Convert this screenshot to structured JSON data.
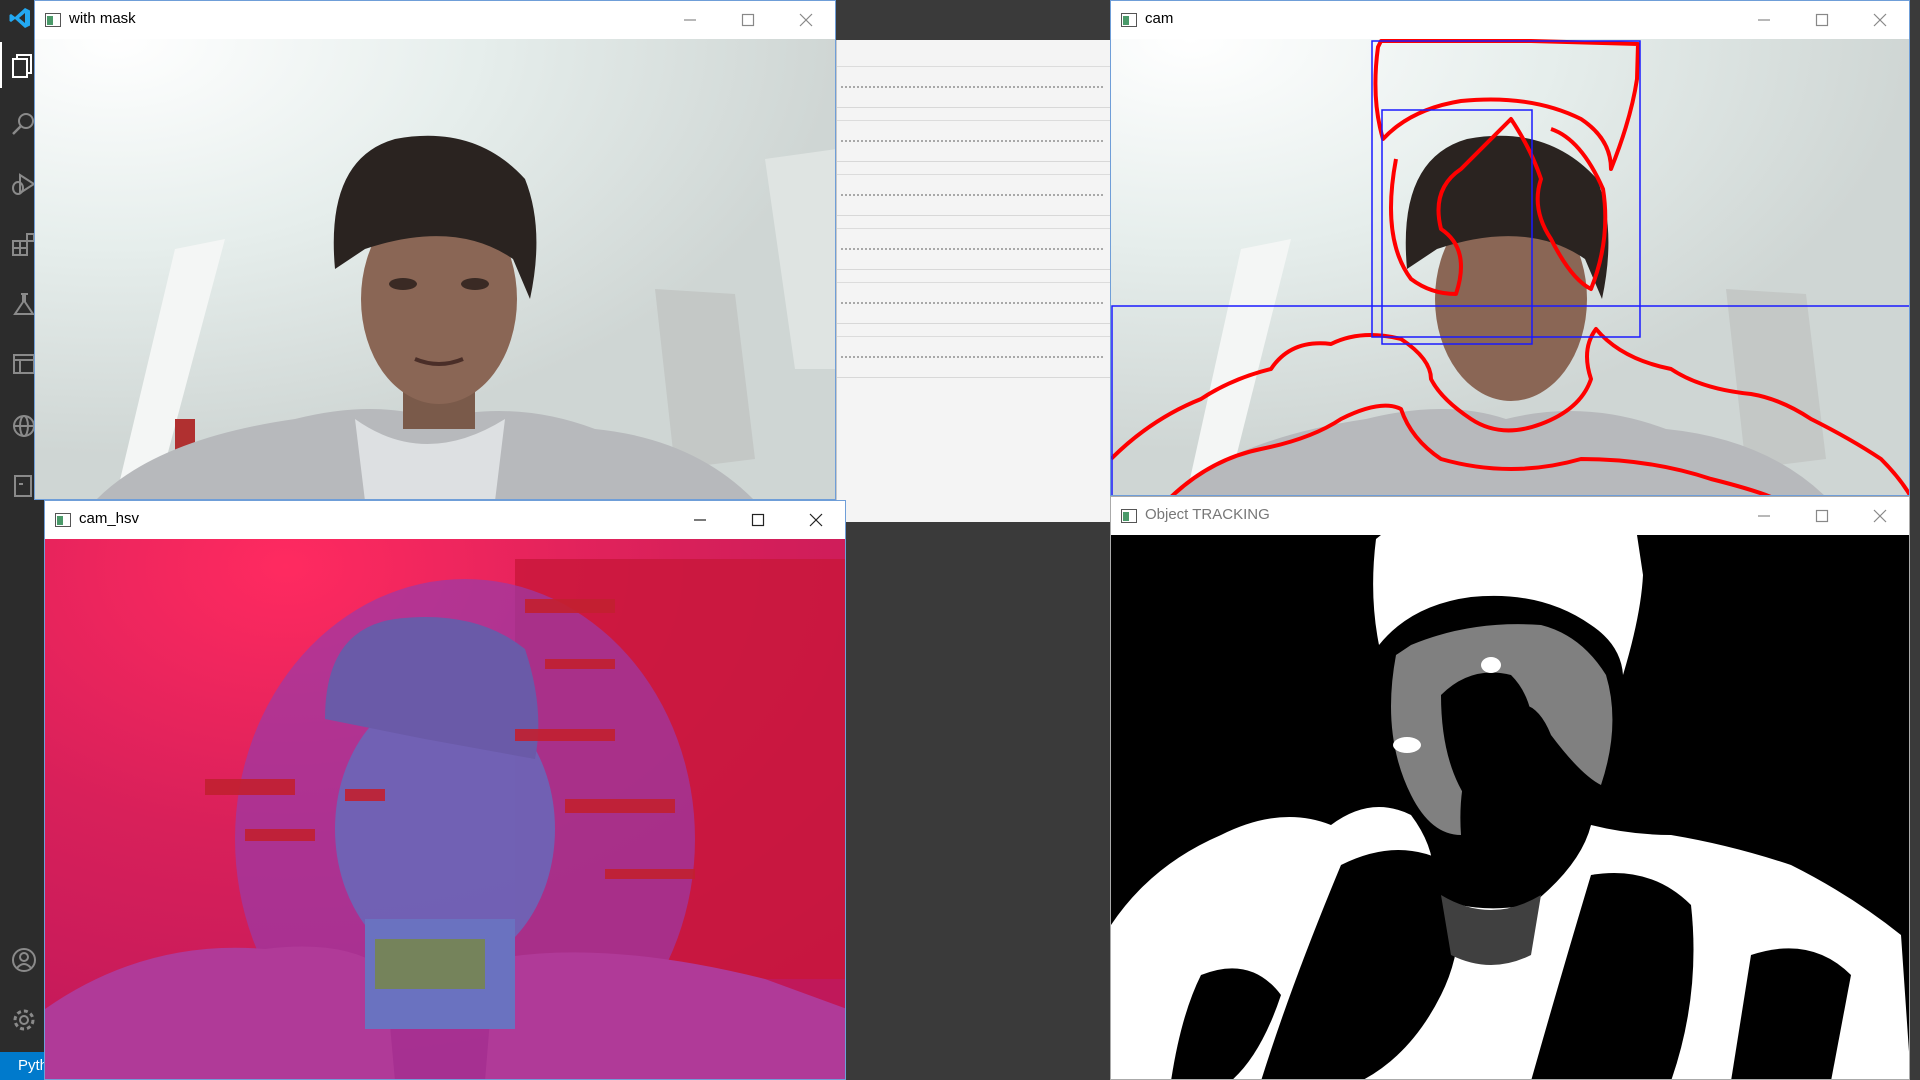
{
  "windows": {
    "with_mask": {
      "title": "with mask"
    },
    "cam": {
      "title": "cam"
    },
    "cam_hsv": {
      "title": "cam_hsv"
    },
    "object_tracking": {
      "title": "Object TRACKING"
    }
  },
  "status_bar": {
    "python_label": "Pyth"
  },
  "activity_bar": {
    "icons": [
      "explorer-icon",
      "search-icon",
      "run-debug-icon",
      "extensions-icon",
      "testing-icon",
      "remote-explorer-icon",
      "browser-icon",
      "database-icon",
      "account-icon",
      "settings-gear-icon"
    ]
  },
  "colors": {
    "activity_bar_bg": "#2c2c2c",
    "status_bar_bg": "#007acc",
    "contour_red": "#ff0000",
    "bounding_box_blue": "#1a1aff",
    "active_window_border": "#6f9ed8"
  }
}
